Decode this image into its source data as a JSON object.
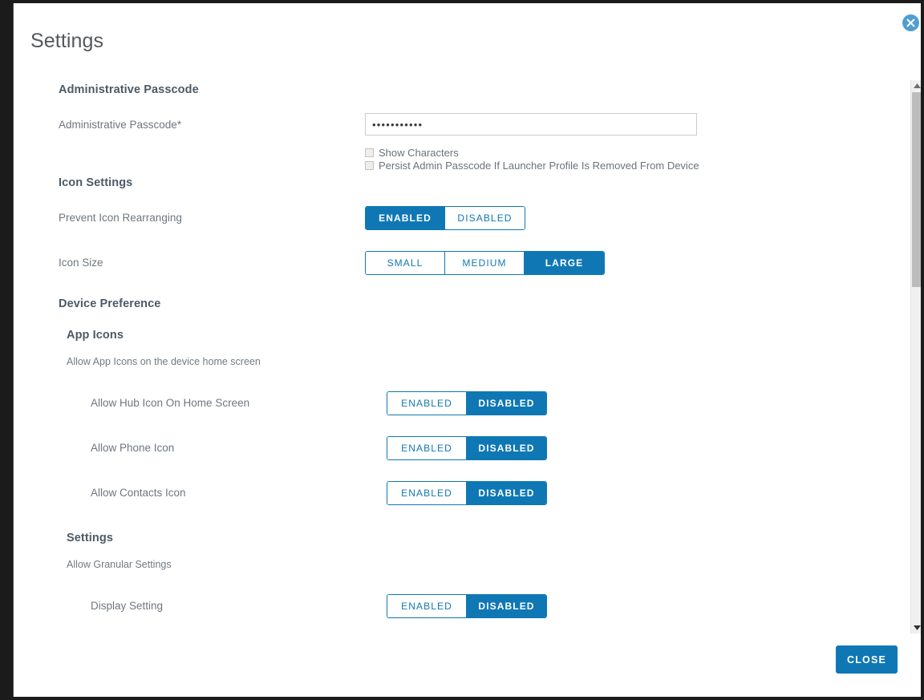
{
  "window": {
    "title": "Settings",
    "close_icon": "close-circle-icon"
  },
  "colors": {
    "accent_blue": "#0f78b4",
    "close_circle": "#4e9fd1",
    "header_text": "#4c5a66",
    "label_text": "#6d7781",
    "scrollbar_thumb": "#bcbcbc"
  },
  "sections": {
    "administrative_passcode": {
      "heading": "Administrative Passcode",
      "field": {
        "label": "Administrative Passcode*",
        "value": "•••••••••••",
        "placeholder": ""
      },
      "checkboxes": [
        {
          "label": "Show Characters",
          "checked": false
        },
        {
          "label": "Persist Admin Passcode If Launcher Profile Is Removed From Device",
          "checked": false
        }
      ]
    },
    "icon_settings": {
      "heading": "Icon Settings",
      "rows": [
        {
          "label": "Prevent Icon Rearranging",
          "options": [
            "ENABLED",
            "DISABLED"
          ],
          "selected": "ENABLED"
        },
        {
          "label": "Icon Size",
          "options": [
            "SMALL",
            "MEDIUM",
            "LARGE"
          ],
          "selected": "LARGE"
        }
      ]
    },
    "device_preference": {
      "heading": "Device Preference",
      "groups": [
        {
          "heading": "App Icons",
          "description": "Allow App Icons on the device home screen",
          "rows": [
            {
              "label": "Allow Hub Icon On Home Screen",
              "options": [
                "ENABLED",
                "DISABLED"
              ],
              "selected": "DISABLED"
            },
            {
              "label": "Allow Phone Icon",
              "options": [
                "ENABLED",
                "DISABLED"
              ],
              "selected": "DISABLED"
            },
            {
              "label": "Allow Contacts Icon",
              "options": [
                "ENABLED",
                "DISABLED"
              ],
              "selected": "DISABLED"
            }
          ]
        },
        {
          "heading": "Settings",
          "description": "Allow Granular Settings",
          "rows": [
            {
              "label": "Display Setting",
              "options": [
                "ENABLED",
                "DISABLED"
              ],
              "selected": "DISABLED"
            }
          ]
        }
      ]
    }
  },
  "scrollbar": {
    "up_arrow": "caret-up-icon",
    "down_arrow": "caret-down-icon"
  },
  "footer": {
    "close_label": "CLOSE"
  }
}
